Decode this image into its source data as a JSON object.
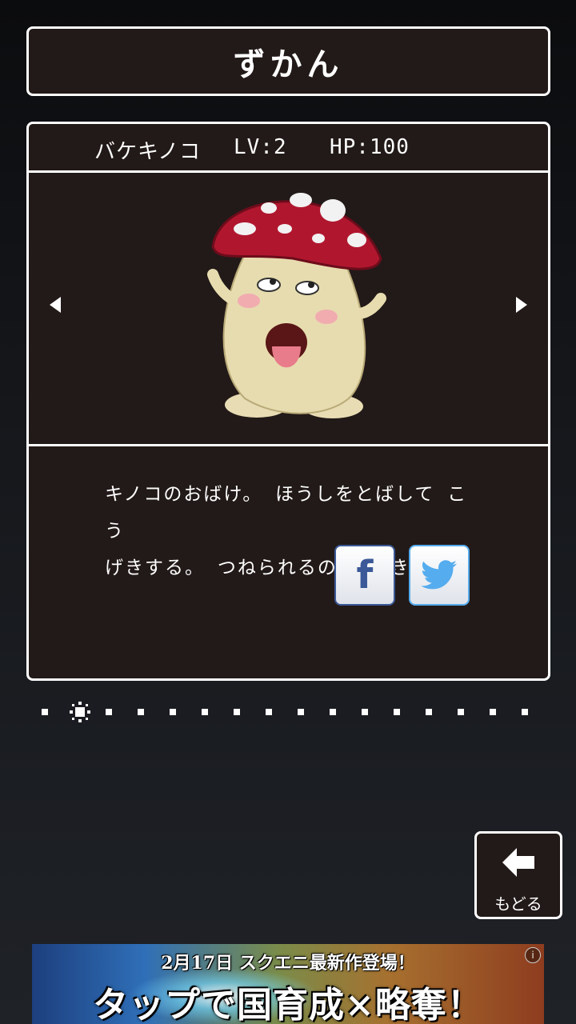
{
  "header": {
    "title": "ずかん"
  },
  "monster": {
    "name": "バケキノコ",
    "level": "LV:2",
    "hp": "HP:100",
    "description_line1": "キノコのおばけ。 ほうしをとばして こう",
    "description_line2": "げきする。 つねられるのが すき。"
  },
  "page_indicator": {
    "total": 16,
    "current": 2
  },
  "navigation": {
    "back_label": "もどる"
  },
  "share": {
    "facebook": "f"
  },
  "ad": {
    "line1": "2月17日 スクエニ最新作登場！",
    "line2": "タップで国育成×略奪！",
    "info": "i"
  },
  "colors": {
    "panel": "#221a18",
    "border": "#ffffff",
    "facebook": "#3b5998",
    "twitter": "#55acee"
  }
}
